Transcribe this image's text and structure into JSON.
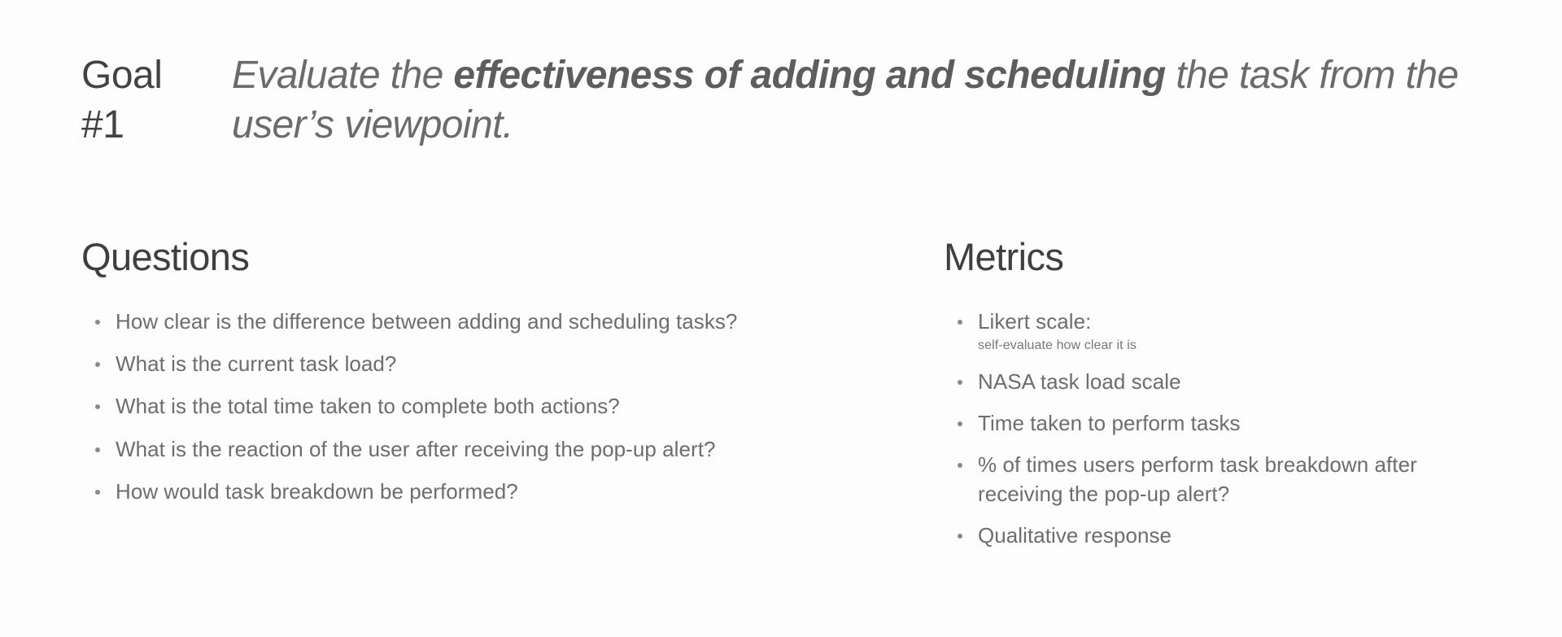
{
  "goal": {
    "label": "Goal\n#1",
    "statement_prefix": "Evaluate the ",
    "statement_emphasis": "effectiveness of adding and scheduling",
    "statement_suffix": " the task from the user’s viewpoint."
  },
  "questions": {
    "title": "Questions",
    "items": [
      "How clear is the difference between adding and scheduling tasks?",
      "What is the current task load?",
      "What is the total time taken to complete both actions?",
      "What is the reaction of the user after receiving the pop-up alert?",
      "How would task breakdown be performed?"
    ]
  },
  "metrics": {
    "title": "Metrics",
    "items": [
      {
        "text": "Likert scale:",
        "sub": "self-evaluate how clear it is"
      },
      {
        "text": "NASA task load scale",
        "sub": ""
      },
      {
        "text": "Time taken to perform tasks",
        "sub": ""
      },
      {
        "text": "% of times users perform task breakdown after receiving the pop-up alert?",
        "sub": ""
      },
      {
        "text": "Qualitative response",
        "sub": ""
      }
    ]
  },
  "colors": {
    "background": "#fdfdfd",
    "heading_text": "#3f3f3f",
    "goal_label_text": "#434343",
    "goal_statement_text": "#6b6b6b",
    "body_text": "#6d6d6d",
    "sub_text": "#777777",
    "bullet": "#8a8a8a"
  }
}
